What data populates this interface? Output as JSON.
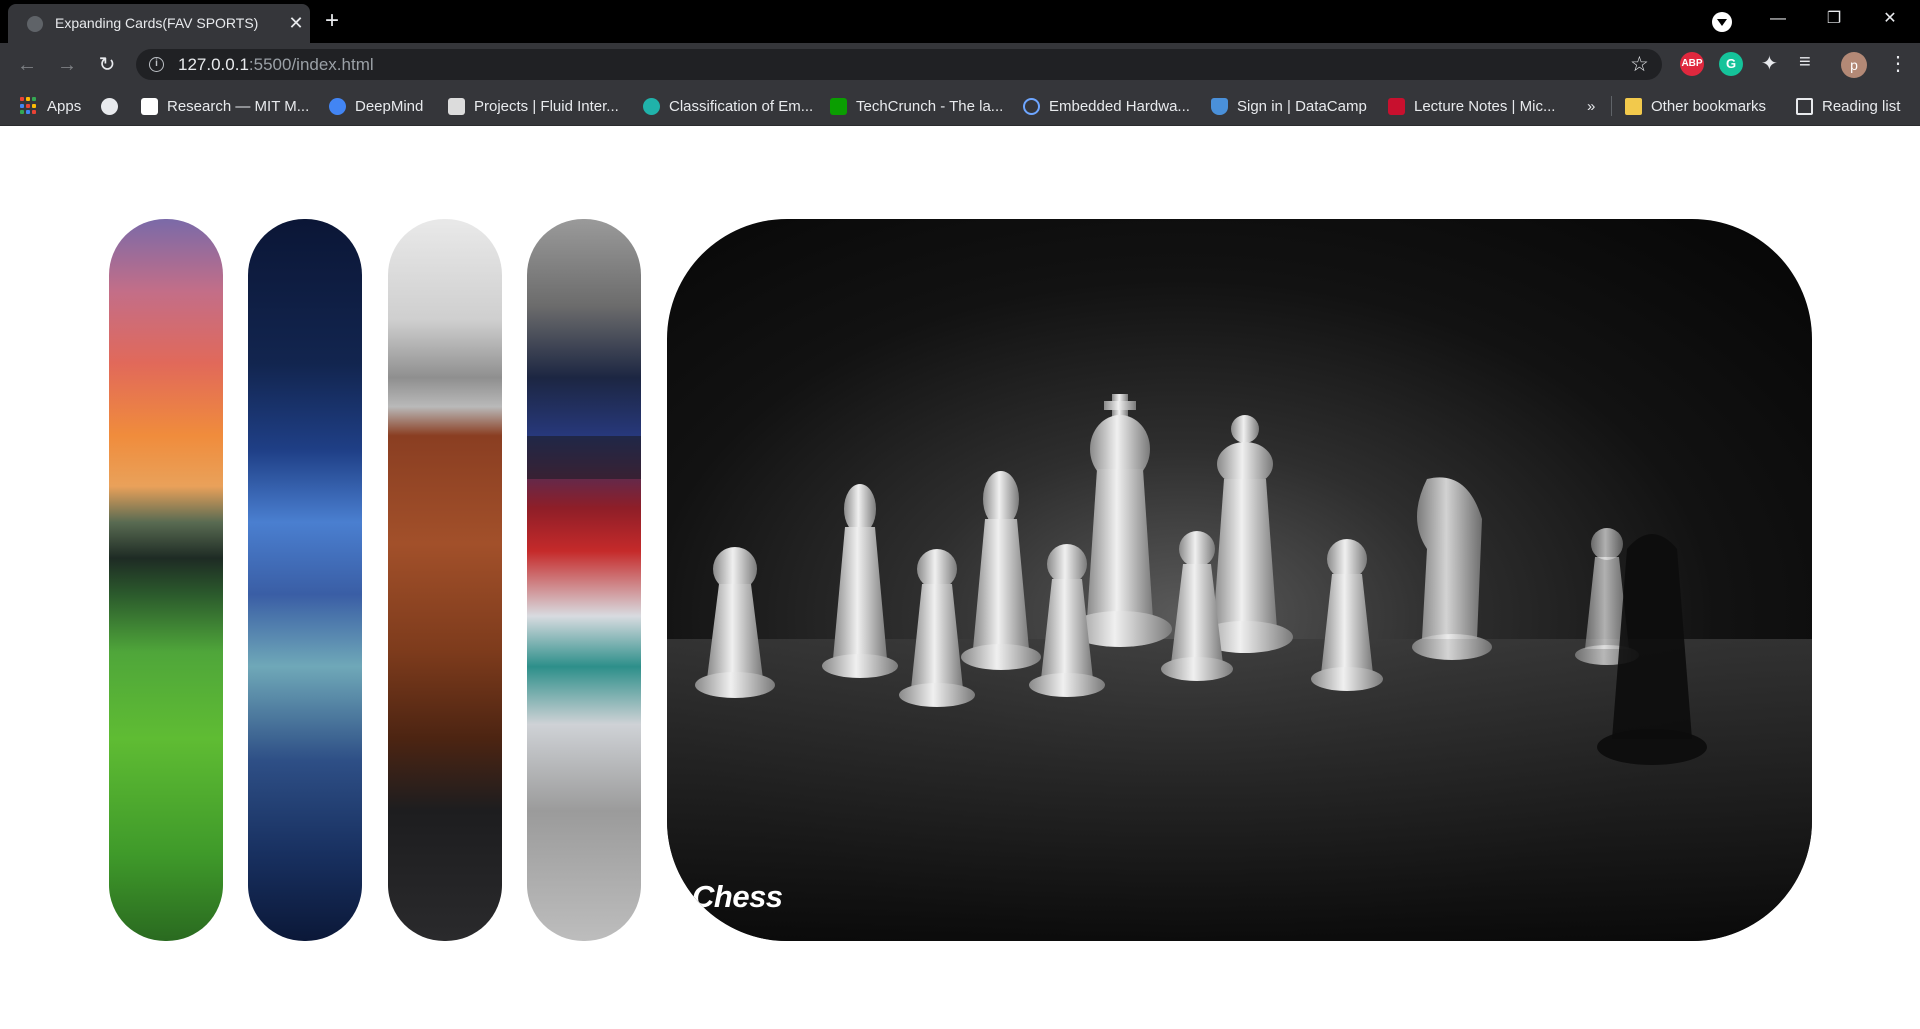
{
  "browser": {
    "tab_title": "Expanding Cards(FAV SPORTS)",
    "tab_close": "✕",
    "new_tab": "+",
    "url_host": "127.0.0.1",
    "url_path": ":5500/index.html",
    "window_controls": {
      "minimize": "—",
      "restore": "❐",
      "close": "✕"
    },
    "profile_initial": "p",
    "extensions": {
      "adblock": "ABP",
      "grammarly": "G"
    }
  },
  "bookmarks": [
    {
      "label": "Apps",
      "icon": "apps-grid-icon"
    },
    {
      "label": "",
      "icon": "globe-icon"
    },
    {
      "label": "Research — MIT M...",
      "icon": "mit-media-lab-icon",
      "color": "#ffffff"
    },
    {
      "label": "DeepMind",
      "icon": "deepmind-icon",
      "color": "#4285f4"
    },
    {
      "label": "Projects | Fluid Inter...",
      "icon": "fluid-interfaces-icon",
      "color": "#dcdcdc"
    },
    {
      "label": "Classification of Em...",
      "icon": "classification-icon",
      "color": "#20b2aa"
    },
    {
      "label": "TechCrunch - The la...",
      "icon": "techcrunch-icon",
      "color": "#0a9e01"
    },
    {
      "label": "Embedded Hardwa...",
      "icon": "infinity-icon",
      "color": "#6ea6ff"
    },
    {
      "label": "Sign in | DataCamp",
      "icon": "datacamp-shield-icon",
      "color": "#4a90d9"
    },
    {
      "label": "Lecture Notes | Mic...",
      "icon": "mit-ocw-icon",
      "color": "#c8102e"
    }
  ],
  "bookmarks_overflow": "»",
  "other_bookmarks": "Other bookmarks",
  "reading_list": "Reading list",
  "cards": [
    {
      "name": "sunset-stadium-card",
      "active": false
    },
    {
      "name": "night-stadium-card",
      "active": false
    },
    {
      "name": "basketball-card",
      "active": false
    },
    {
      "name": "formula-one-card",
      "active": false
    },
    {
      "name": "chess-card",
      "active": true,
      "title": "Chess"
    }
  ]
}
